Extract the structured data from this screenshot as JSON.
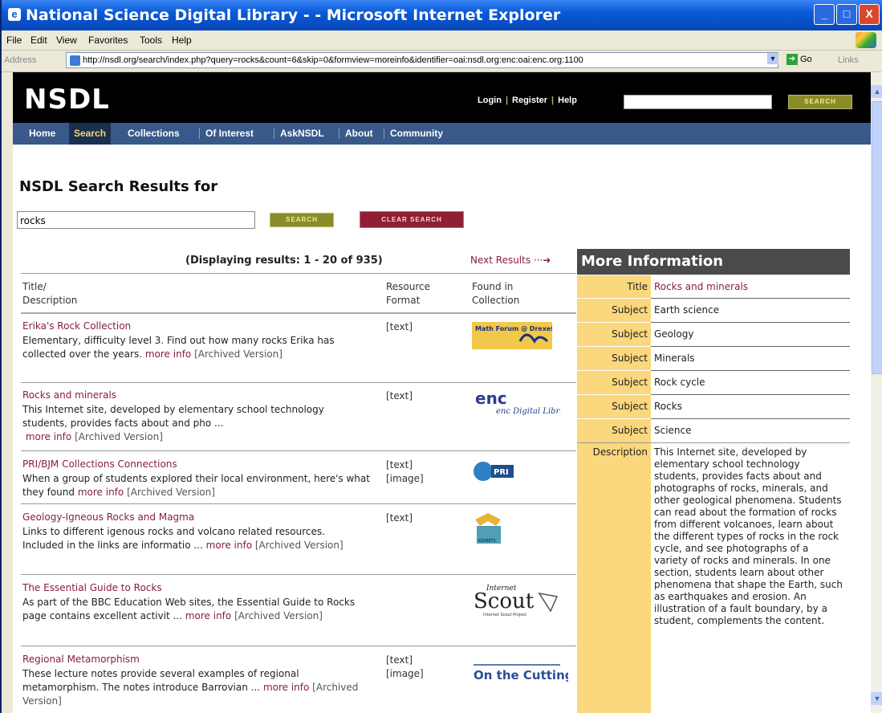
{
  "window": {
    "title": "National Science Digital Library - - Microsoft Internet Explorer",
    "min": "_",
    "max": "□",
    "close": "X"
  },
  "menu": [
    "File",
    "Edit",
    "View",
    "Favorites",
    "Tools",
    "Help"
  ],
  "address": {
    "label": "Address",
    "url": "http://nsdl.org/search/index.php?query=rocks&count=6&skip=0&formview=moreinfo&identifier=oai:nsdl.org:enc:oai:enc.org:1100",
    "go": "Go",
    "links": "Links"
  },
  "site": {
    "logo_main": "NSDL",
    "login": "Login",
    "register": "Register",
    "help": "Help",
    "top_search_button": "SEARCH"
  },
  "nav": [
    "Home",
    "Search",
    "Collections",
    "Of Interest",
    "AskNSDL",
    "About",
    "Community"
  ],
  "search": {
    "heading": "NSDL Search Results for",
    "query": "rocks",
    "search_button": "SEARCH",
    "clear_button": "CLEAR SEARCH"
  },
  "results": {
    "displaying": "(Displaying results: 1 - 20 of 935)",
    "next": "Next Results",
    "col_title": "Title/",
    "col_desc": "Description",
    "col_format_1": "Resource",
    "col_format_2": "Format",
    "col_found_1": "Found in",
    "col_found_2": "Collection",
    "more_info": "more info",
    "archived": "[Archived Version]",
    "items": [
      {
        "title": "Erika's Rock Collection",
        "desc": "Elementary, difficulty level 3. Find out how many rocks Erika has collected over the years.",
        "format": "[text]",
        "collection": "Math Forum @ Drexel University"
      },
      {
        "title": "Rocks and minerals",
        "desc": "This Internet site, developed by elementary school technology students, provides facts about and pho ...",
        "format": "[text]",
        "collection": "enc Digital Library"
      },
      {
        "title": "PRI/BJM Collections Connections",
        "desc": "When a group of students explored their local environment, here's what they found",
        "format": "[text]\n[image]",
        "collection": "PRI"
      },
      {
        "title": "Geology-Igneous Rocks and Magma",
        "desc": "Links to different igenous rocks and volcano related resources. Included in the links are informatio ...",
        "format": "[text]",
        "collection": "KIDNETS"
      },
      {
        "title": "The Essential Guide to Rocks",
        "desc": "As part of the BBC Education Web sites, the Essential Guide to Rocks page contains excellent activit ...",
        "format": "",
        "collection": "Internet Scout Project"
      },
      {
        "title": "Regional Metamorphism",
        "desc": "These lecture notes provide several examples of regional metamorphism. The notes introduce Barrovian ...",
        "format": "[text]\n[image]",
        "collection": "On the Cutting Edge"
      }
    ]
  },
  "more_info": {
    "heading": "More Information",
    "title_label": "Title",
    "title_value": "Rocks and minerals",
    "subject_label": "Subject",
    "subjects": [
      "Earth science",
      "Geology",
      "Minerals",
      "Rock cycle",
      "Rocks",
      "Science"
    ],
    "description_label": "Description",
    "description": "This Internet site, developed by elementary school technology students, provides facts about and photographs of rocks, minerals, and other geological phenomena. Students can read about the formation of rocks from different volcanoes, learn about the different types of rocks in the rock cycle, and see photographs of a variety of rocks and minerals. In one section, students learn about other phenomena that shape the Earth, such as earthquakes and erosion. An illustration of a fault boundary, by a student, complements the content."
  },
  "colors": {
    "link": "#862038",
    "nav_bg": "#38598a",
    "info_label_bg": "#fbd77d"
  }
}
